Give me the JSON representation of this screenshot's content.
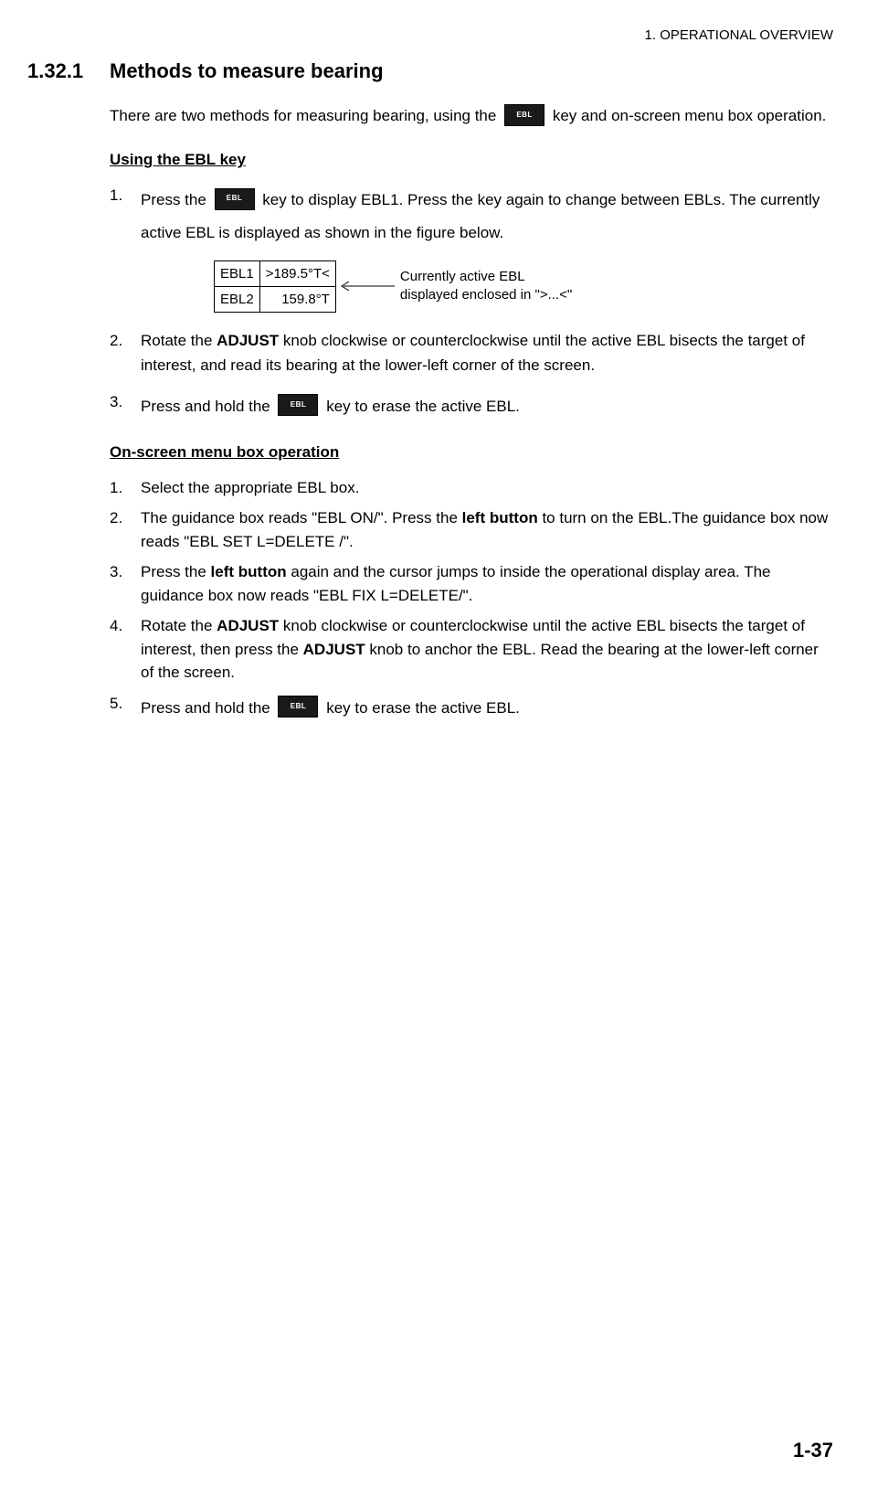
{
  "header": "1.  OPERATIONAL OVERVIEW",
  "section": {
    "number": "1.32.1",
    "title": "Methods to measure bearing"
  },
  "intro": {
    "before_key": "There are two methods for measuring bearing, using the ",
    "after_key": " key and on-screen menu box operation."
  },
  "ebl_key_label": "EBL",
  "subA": {
    "heading": "Using the EBL key",
    "step1": {
      "before_key": "Press the ",
      "after_key": " key to display EBL1. Press the key again to change between EBLs. The currently active EBL is displayed as shown in the figure below."
    },
    "figure": {
      "row1_label": "EBL1",
      "row1_value": ">189.5°T<",
      "row2_label": "EBL2",
      "row2_value": "159.8°T",
      "callout_line1": "Currently active EBL",
      "callout_line2": "displayed enclosed in \">...<\""
    },
    "step2": {
      "pre": "Rotate the ",
      "bold": "ADJUST",
      "post": " knob clockwise or counterclockwise until the active EBL bisects the target of interest, and read its bearing at the lower-left corner of the screen."
    },
    "step3": {
      "before_key": "Press and hold the ",
      "after_key": " key to erase the active EBL."
    }
  },
  "subB": {
    "heading": "On-screen menu box operation",
    "step1": "Select the appropriate EBL box.",
    "step2": {
      "pre": "The guidance box reads \"EBL ON/\". Press the ",
      "bold": "left button",
      "post": " to turn on the EBL.The guidance box now reads \"EBL SET L=DELETE /\"."
    },
    "step3": {
      "pre": "Press the ",
      "bold": "left button",
      "post": " again and the cursor jumps to inside the operational display area. The guidance box now reads \"EBL FIX L=DELETE/\"."
    },
    "step4": {
      "pre": "Rotate the ",
      "bold1": "ADJUST",
      "mid": " knob clockwise or counterclockwise until the active EBL bisects the target of interest, then press the ",
      "bold2": "ADJUST",
      "post": " knob to anchor the EBL. Read the bearing at the lower-left corner of the screen."
    },
    "step5": {
      "before_key": "Press and hold the ",
      "after_key": " key to erase the active EBL."
    }
  },
  "page_number": "1-37"
}
